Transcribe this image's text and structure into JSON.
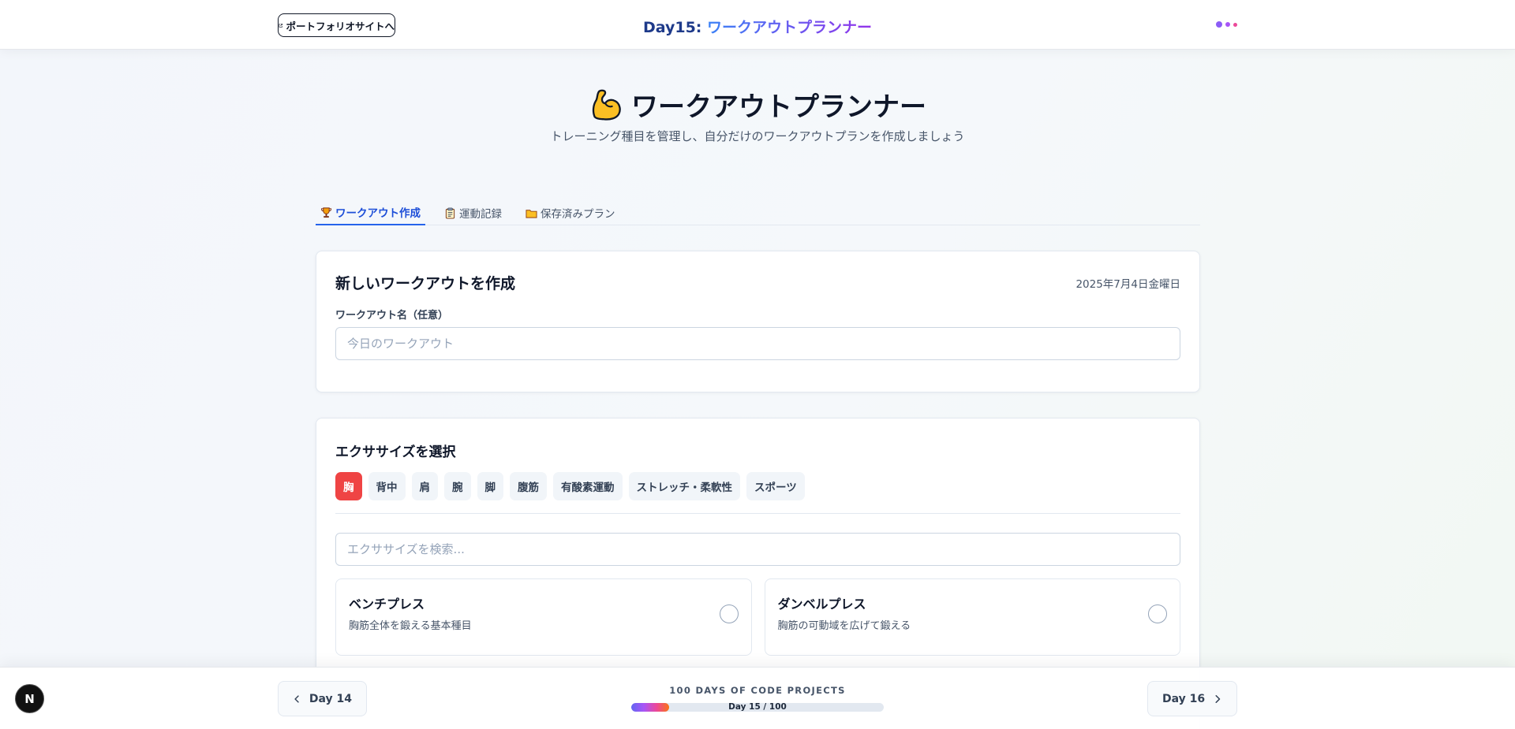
{
  "header": {
    "portfolio_label": "ポートフォリオサイトへ",
    "title_prefix": "Day15: ",
    "title_main": "ワークアウトプランナー"
  },
  "hero": {
    "title": "ワークアウトプランナー",
    "subtitle": "トレーニング種目を管理し、自分だけのワークアウトプランを作成しましょう"
  },
  "tabs": [
    {
      "label": "ワークアウト作成",
      "icon": "trophy-icon",
      "active": true
    },
    {
      "label": "運動記録",
      "icon": "clipboard-icon",
      "active": false
    },
    {
      "label": "保存済みプラン",
      "icon": "folder-icon",
      "active": false
    }
  ],
  "create_card": {
    "title": "新しいワークアウトを作成",
    "date": "2025年7月4日金曜日",
    "name_label": "ワークアウト名（任意）",
    "name_placeholder": "今日のワークアウト",
    "name_value": ""
  },
  "exercise_card": {
    "title": "エクササイズを選択",
    "categories": [
      "胸",
      "背中",
      "肩",
      "腕",
      "脚",
      "腹筋",
      "有酸素運動",
      "ストレッチ・柔軟性",
      "スポーツ"
    ],
    "active_category": "胸",
    "search_placeholder": "エクササイズを検索...",
    "exercises": [
      {
        "name": "ベンチプレス",
        "desc": "胸筋全体を鍛える基本種目",
        "selected": false
      },
      {
        "name": "ダンベルプレス",
        "desc": "胸筋の可動域を広げて鍛える",
        "selected": false
      }
    ]
  },
  "footer": {
    "prev_label": "Day 14",
    "next_label": "Day 16",
    "series_label": "100 DAYS OF CODE PROJECTS",
    "progress_text": "Day 15 / 100",
    "progress_fraction": 0.15
  },
  "badge": {
    "letter": "N"
  },
  "colors": {
    "accent": "#2563eb",
    "active_category": "#ef4444",
    "title_gradient_start": "#3b82f6",
    "title_gradient_end": "#9333ea"
  }
}
